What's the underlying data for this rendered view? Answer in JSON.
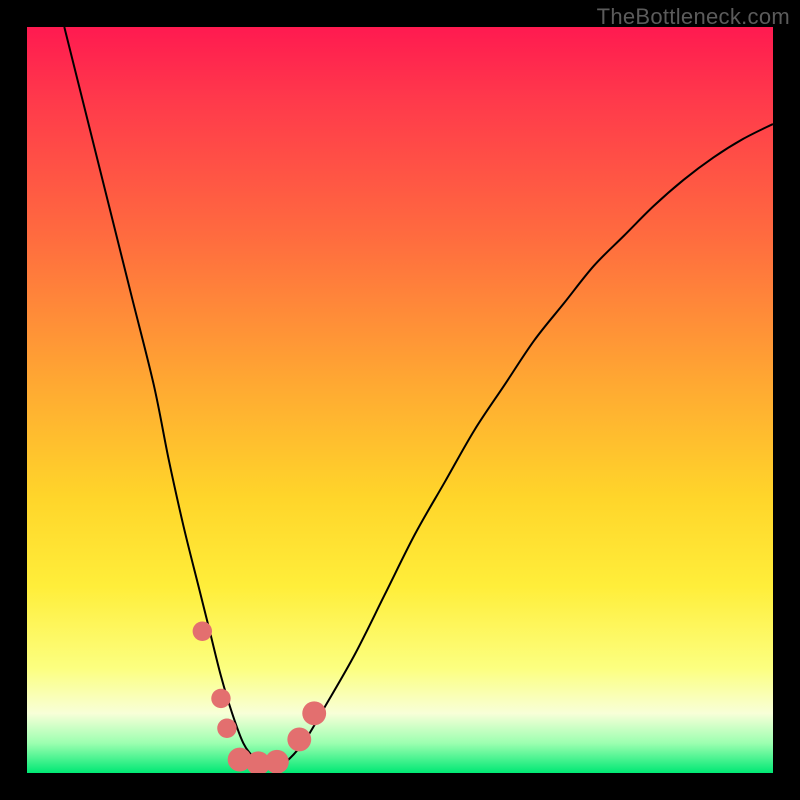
{
  "watermark": "TheBottleneck.com",
  "chart_data": {
    "type": "line",
    "title": "",
    "xlabel": "",
    "ylabel": "",
    "xlim": [
      0,
      100
    ],
    "ylim": [
      0,
      100
    ],
    "grid": false,
    "series": [
      {
        "name": "curve",
        "x": [
          5,
          8,
          11,
          14,
          17,
          19,
          21,
          23,
          24.5,
          26,
          27.5,
          29,
          30.5,
          32,
          34,
          37,
          40,
          44,
          48,
          52,
          56,
          60,
          64,
          68,
          72,
          76,
          80,
          84,
          88,
          92,
          96,
          100
        ],
        "y": [
          100,
          88,
          76,
          64,
          52,
          42,
          33,
          25,
          19,
          13,
          8,
          4,
          2,
          1,
          1,
          4,
          9,
          16,
          24,
          32,
          39,
          46,
          52,
          58,
          63,
          68,
          72,
          76,
          79.5,
          82.5,
          85,
          87
        ]
      }
    ],
    "markers": [
      {
        "x": 23.5,
        "y": 19,
        "r": 1.3
      },
      {
        "x": 26.0,
        "y": 10,
        "r": 1.3
      },
      {
        "x": 26.8,
        "y": 6,
        "r": 1.3
      },
      {
        "x": 28.5,
        "y": 1.8,
        "r": 1.6
      },
      {
        "x": 31.0,
        "y": 1.3,
        "r": 1.6
      },
      {
        "x": 33.5,
        "y": 1.5,
        "r": 1.6
      },
      {
        "x": 36.5,
        "y": 4.5,
        "r": 1.6
      },
      {
        "x": 38.5,
        "y": 8.0,
        "r": 1.6
      }
    ],
    "marker_color": "#e36f6f",
    "curve_color": "#000000"
  }
}
